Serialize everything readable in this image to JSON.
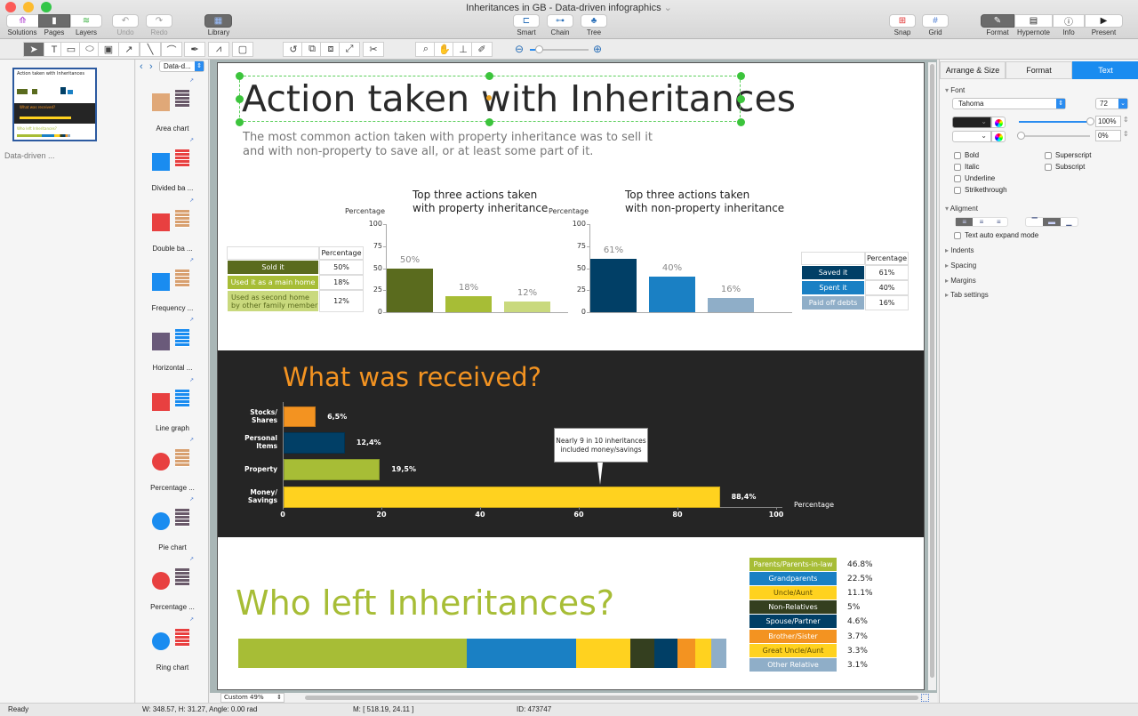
{
  "window": {
    "title": "Inheritances in GB - Data-driven infographics"
  },
  "toolbar": {
    "left": [
      {
        "label": "Solutions"
      },
      {
        "label": "Pages"
      },
      {
        "label": "Layers"
      },
      {
        "label": "Undo"
      },
      {
        "label": "Redo"
      },
      {
        "label": "Library"
      }
    ],
    "center": [
      {
        "label": "Smart"
      },
      {
        "label": "Chain"
      },
      {
        "label": "Tree"
      }
    ],
    "right": [
      {
        "label": "Snap"
      },
      {
        "label": "Grid"
      },
      {
        "label": "Format"
      },
      {
        "label": "Hypernote"
      },
      {
        "label": "Info"
      },
      {
        "label": "Present"
      }
    ]
  },
  "pages_panel": {
    "page_name": "Data-driven ..."
  },
  "library": {
    "dropdown": "Data-d...",
    "items": [
      {
        "label": "Area chart"
      },
      {
        "label": "Divided ba ..."
      },
      {
        "label": "Double ba ..."
      },
      {
        "label": "Frequency ..."
      },
      {
        "label": "Horizontal ..."
      },
      {
        "label": "Line graph"
      },
      {
        "label": "Percentage ..."
      },
      {
        "label": "Pie chart"
      },
      {
        "label": "Percentage ..."
      },
      {
        "label": "Ring chart"
      }
    ]
  },
  "canvas": {
    "zoom": "Custom 49%",
    "title": "Action taken with Inheritances",
    "subtitle_line1": "The most common action taken with property inheritance was to sell it",
    "subtitle_line2": "and with non-property to save all, or at least some part of it.",
    "dark_title": "What was received?",
    "who_title": "Who left Inheritances?"
  },
  "chart_data": [
    {
      "type": "bar",
      "title": "Top three actions taken with property inheritance",
      "title_line1": "Top three actions taken",
      "title_line2": "with property inheritance",
      "ylabel": "Percentage",
      "ylim": [
        0,
        100
      ],
      "yticks": [
        "0",
        "25",
        "50",
        "75",
        "100"
      ],
      "categories": [
        "Sold it",
        "Used it as a main home",
        "Used as second home by other family member"
      ],
      "values": [
        50,
        18,
        12
      ],
      "labels": [
        "50%",
        "18%",
        "12%"
      ],
      "colors": [
        "#5a6b1e",
        "#a7bd36",
        "#c9d97d"
      ],
      "table_header": "Percentage",
      "table_rows": [
        {
          "name": "Sold it",
          "value": "50%"
        },
        {
          "name": "Used it as a main home",
          "value": "18%"
        },
        {
          "name_line1": "Used as second home",
          "name_line2": "by other family member",
          "value": "12%"
        }
      ]
    },
    {
      "type": "bar",
      "title": "Top three actions taken with non-property inheritance",
      "title_line1": "Top three actions taken",
      "title_line2": "with non-property inheritance",
      "ylabel": "Percentage",
      "ylim": [
        0,
        100
      ],
      "yticks": [
        "0",
        "25",
        "50",
        "75",
        "100"
      ],
      "categories": [
        "Saved it",
        "Spent it",
        "Paid off debts"
      ],
      "values": [
        61,
        40,
        16
      ],
      "labels": [
        "61%",
        "40%",
        "16%"
      ],
      "colors": [
        "#013f66",
        "#1a80c4",
        "#8faec8"
      ],
      "table_header": "Percentage",
      "table_rows": [
        {
          "name": "Saved it",
          "value": "61%"
        },
        {
          "name": "Spent it",
          "value": "40%"
        },
        {
          "name": "Paid off debts",
          "value": "16%"
        }
      ]
    },
    {
      "type": "bar",
      "orientation": "horizontal",
      "title": "What was received?",
      "xlabel": "Percentage",
      "xlim": [
        0,
        100
      ],
      "xticks": [
        "0",
        "20",
        "40",
        "60",
        "80",
        "100"
      ],
      "categories": [
        {
          "line1": "Stocks/",
          "line2": "Shares"
        },
        {
          "line1": "Personal",
          "line2": "Items"
        },
        {
          "line1": "Property",
          "line2": ""
        },
        {
          "line1": "Money/",
          "line2": "Savings"
        }
      ],
      "values": [
        6.5,
        12.4,
        19.5,
        88.4
      ],
      "labels": [
        "6,5%",
        "12,4%",
        "19,5%",
        "88,4%"
      ],
      "colors": [
        "#f39321",
        "#013f66",
        "#a7bd36",
        "#ffd21f"
      ],
      "annotation_line1": "Nearly 9 in 10 inheritances",
      "annotation_line2": "included money/savings"
    },
    {
      "type": "bar",
      "orientation": "stacked-horizontal",
      "title": "Who left Inheritances?",
      "categories": [
        "Parents/Parents-in-law",
        "Grandparents",
        "Uncle/Aunt",
        "Non-Relatives",
        "Spouse/Partner",
        "Brother/Sister",
        "Great Uncle/Aunt",
        "Other Relative"
      ],
      "values": [
        46.8,
        22.5,
        11.1,
        5,
        4.6,
        3.7,
        3.3,
        3.1
      ],
      "labels": [
        "46.8%",
        "22.5%",
        "11.1%",
        "5%",
        "4.6%",
        "3.7%",
        "3.3%",
        "3.1%"
      ],
      "colors": [
        "#a7bd36",
        "#1a80c4",
        "#ffd21f",
        "#343f1f",
        "#013f66",
        "#f39321",
        "#ffd21f",
        "#8faec8"
      ],
      "text_colors": [
        "#fff",
        "#fff",
        "#5a4b00",
        "#fff",
        "#fff",
        "#fff",
        "#5a4b00",
        "#fff"
      ]
    }
  ],
  "inspector": {
    "tabs": [
      {
        "label": "Arrange & Size"
      },
      {
        "label": "Format"
      },
      {
        "label": "Text"
      }
    ],
    "font_section": "Font",
    "font_name": "Tahoma",
    "font_size": "72",
    "opacity1": "100%",
    "opacity2": "0%",
    "checkboxes_left": [
      "Bold",
      "Italic",
      "Underline",
      "Strikethrough"
    ],
    "checkboxes_right": [
      "Superscript",
      "Subscript"
    ],
    "alignment_section": "Aligment",
    "auto_expand": "Text auto expand mode",
    "collapsed": [
      "Indents",
      "Spacing",
      "Margins",
      "Tab settings"
    ]
  },
  "status": {
    "state": "Ready",
    "dims": "W: 348.57,  H: 31.27,  Angle: 0.00 rad",
    "mouse": "M: [ 518.19, 24.11 ]",
    "id": "ID: 473747"
  }
}
